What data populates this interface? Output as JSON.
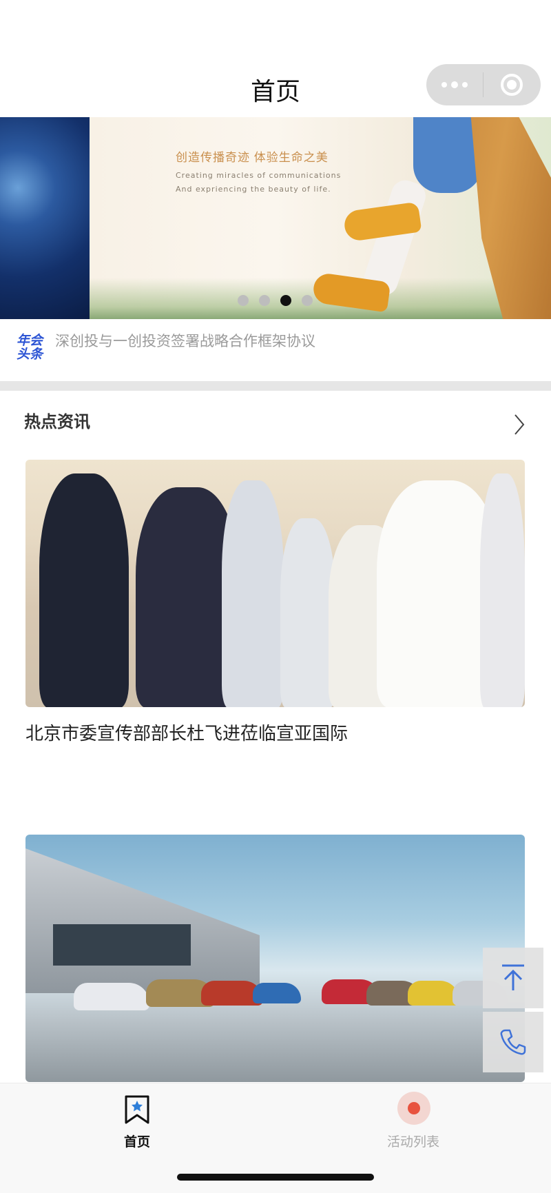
{
  "header": {
    "title": "首页"
  },
  "banner": {
    "slogan_cn": "创造传播奇迹  体验生命之美",
    "slogan_en_line1": "Creating miracles of communications",
    "slogan_en_line2": "And expriencing the beauty of life.",
    "indicator": {
      "count": 4,
      "active_index": 2
    }
  },
  "ticker": {
    "logo_line1": "年会",
    "logo_line2": "头条",
    "text": "深创投与一创投资签署战略合作框架协议"
  },
  "section": {
    "title": "热点资讯"
  },
  "news": [
    {
      "title": "北京市委宣传部部长杜飞进莅临宣亚国际"
    },
    {
      "title": ""
    }
  ],
  "floating": {
    "top_icon": "arrow-up-to-top-icon",
    "phone_icon": "phone-icon"
  },
  "tabbar": {
    "items": [
      {
        "label": "首页",
        "icon": "bookmark-star-icon",
        "active": true
      },
      {
        "label": "活动列表",
        "icon": "record-dot-icon",
        "active": false
      }
    ]
  },
  "colors": {
    "accent_blue": "#2c54d4",
    "record_red": "#e8533f",
    "divider": "#e6e6e6"
  }
}
